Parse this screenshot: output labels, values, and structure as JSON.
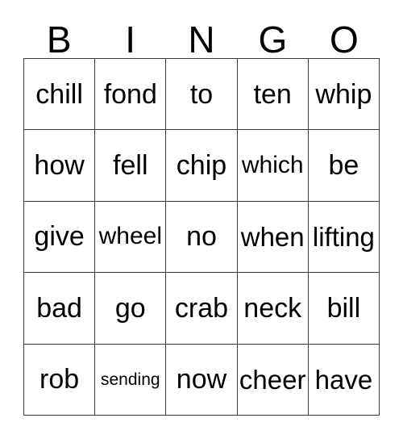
{
  "card": {
    "title_letters": [
      "B",
      "I",
      "N",
      "G",
      "O"
    ],
    "border_color": "#3a3a3a",
    "text_color": "#000000",
    "background_color": "#ffffff",
    "rows": [
      [
        {
          "word": "chill",
          "size": "sz-full"
        },
        {
          "word": "fond",
          "size": "sz-full"
        },
        {
          "word": "to",
          "size": "sz-full"
        },
        {
          "word": "ten",
          "size": "sz-full"
        },
        {
          "word": "whip",
          "size": "sz-full"
        }
      ],
      [
        {
          "word": "how",
          "size": "sz-full"
        },
        {
          "word": "fell",
          "size": "sz-full"
        },
        {
          "word": "chip",
          "size": "sz-full"
        },
        {
          "word": "which",
          "size": "sz-mid"
        },
        {
          "word": "be",
          "size": "sz-full"
        }
      ],
      [
        {
          "word": "give",
          "size": "sz-full"
        },
        {
          "word": "wheel",
          "size": "sz-mid"
        },
        {
          "word": "no",
          "size": "sz-full"
        },
        {
          "word": "when",
          "size": "sz-wide"
        },
        {
          "word": "lifting",
          "size": "sz-wide"
        }
      ],
      [
        {
          "word": "bad",
          "size": "sz-full"
        },
        {
          "word": "go",
          "size": "sz-full"
        },
        {
          "word": "crab",
          "size": "sz-full"
        },
        {
          "word": "neck",
          "size": "sz-full"
        },
        {
          "word": "bill",
          "size": "sz-full"
        }
      ],
      [
        {
          "word": "rob",
          "size": "sz-full"
        },
        {
          "word": "sending",
          "size": "sz-small"
        },
        {
          "word": "now",
          "size": "sz-full"
        },
        {
          "word": "cheer",
          "size": "sz-wide"
        },
        {
          "word": "have",
          "size": "sz-wide"
        }
      ]
    ]
  }
}
